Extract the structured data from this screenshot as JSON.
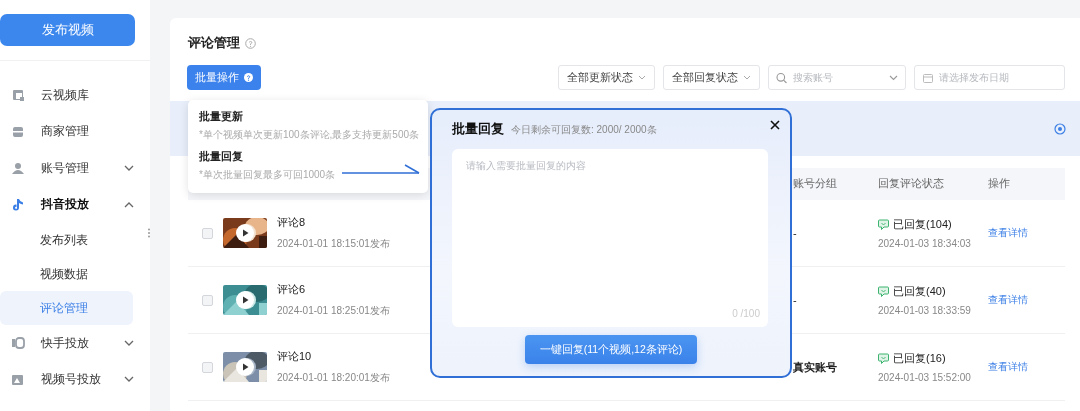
{
  "sidebar": {
    "publish_button": "发布视频",
    "items": [
      {
        "kind": "link",
        "label": "云视频库"
      },
      {
        "kind": "link",
        "label": "商家管理"
      },
      {
        "kind": "group",
        "label": "账号管理",
        "expanded": false
      },
      {
        "kind": "group",
        "label": "抖音投放",
        "expanded": true,
        "children": [
          {
            "label": "发布列表",
            "selected": false
          },
          {
            "label": "视频数据",
            "selected": false
          },
          {
            "label": "评论管理",
            "selected": true
          }
        ]
      },
      {
        "kind": "group",
        "label": "快手投放",
        "expanded": false
      },
      {
        "kind": "group",
        "label": "视频号投放",
        "expanded": false
      }
    ]
  },
  "page": {
    "title": "评论管理",
    "batch_button": "批量操作",
    "filters": [
      {
        "kind": "select",
        "value": "全部更新状态"
      },
      {
        "kind": "select",
        "value": "全部回复状态"
      },
      {
        "kind": "search",
        "placeholder": "搜索账号"
      },
      {
        "kind": "date",
        "placeholder": "请选择发布日期"
      }
    ]
  },
  "table": {
    "columns": [
      "账号分组",
      "回复评论状态",
      "操作"
    ],
    "rows": [
      {
        "checked": false,
        "title": "评论8",
        "published": "2024-01-01 18:15:01发布",
        "account_group": "-",
        "status": "已回复(104)",
        "status_time": "2024-01-03 18:34:03",
        "action": "查看详情"
      },
      {
        "checked": false,
        "title": "评论6",
        "published": "2024-01-01 18:25:01发布",
        "account_group": "-",
        "status": "已回复(40)",
        "status_time": "2024-01-03 18:33:59",
        "action": "查看详情"
      },
      {
        "checked": false,
        "title": "评论10",
        "published": "2024-01-01 18:20:01发布",
        "account_group": "真实账号",
        "status": "已回复(16)",
        "status_time": "2024-01-03 15:52:00",
        "action": "查看详情"
      }
    ]
  },
  "batch_menu": {
    "items": [
      {
        "title": "批量更新",
        "hint": "*单个视频单次更新100条评论,最多支持更新500条"
      },
      {
        "title": "批量回复",
        "hint": "*单次批量回复最多可回1000条"
      }
    ]
  },
  "reply_modal": {
    "title": "批量回复",
    "quota": "今日剩余可回复数: 2000/ 2000条",
    "placeholder": "请输入需要批量回复的内容",
    "counter": "0 /100",
    "submit": "一键回复(11个视频,12条评论)"
  }
}
